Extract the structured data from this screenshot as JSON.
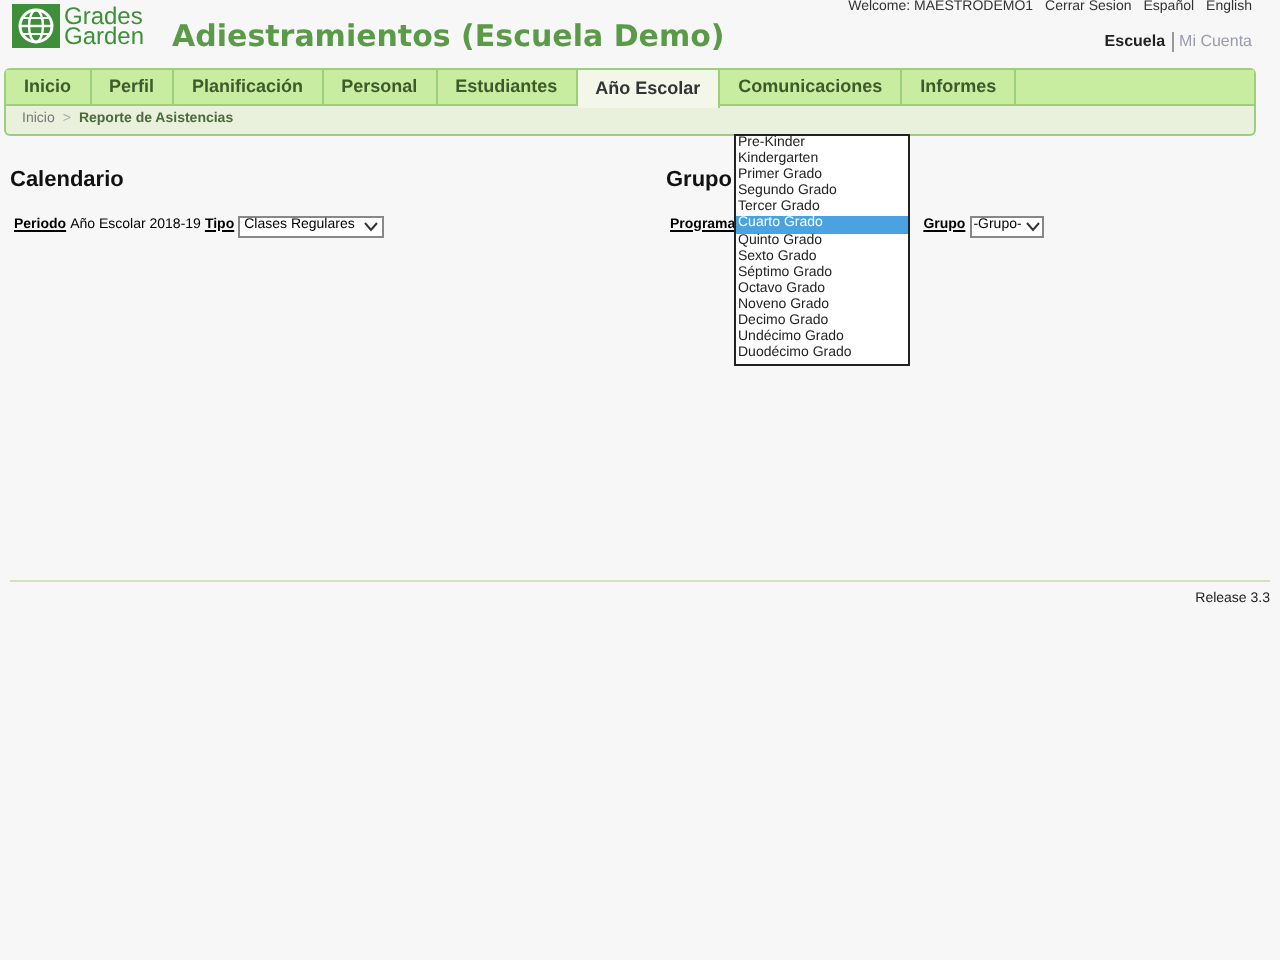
{
  "header": {
    "logo": {
      "line_1": "Grades",
      "line_2": "Garden"
    },
    "title": "Adiestramientos (Escuela Demo)",
    "user_links": [
      "Welcome: MAESTRODEMO1",
      "Cerrar Sesion",
      "Español",
      "English"
    ],
    "account_links": [
      {
        "label": "Escuela",
        "selected": true
      },
      {
        "label": "Mi Cuenta",
        "selected": false
      }
    ]
  },
  "nav_tabs": [
    {
      "label": "Inicio",
      "selected": false
    },
    {
      "label": "Perfil",
      "selected": false
    },
    {
      "label": "Planificación",
      "selected": false
    },
    {
      "label": "Personal",
      "selected": false
    },
    {
      "label": "Estudiantes",
      "selected": false
    },
    {
      "label": "Año Escolar",
      "selected": true
    },
    {
      "label": "Comunicaciones",
      "selected": false
    },
    {
      "label": "Informes",
      "selected": false
    }
  ],
  "breadcrumb": [
    "Inicio",
    "Reporte de Asistencias"
  ],
  "breadcrumb_separator": ">",
  "calendar": {
    "heading": "Calendario",
    "period_label": "Periodo",
    "period_value": "Año Escolar 2018-19",
    "type_label": "Tipo",
    "type_value": "Clases Regulares"
  },
  "group": {
    "heading": "Grupo",
    "program_label": "Programa",
    "group_label": "Grupo",
    "group_value": "-Grupo-",
    "program_options": [
      {
        "label": "Pre-Kinder",
        "selected": false
      },
      {
        "label": "Kindergarten",
        "selected": false
      },
      {
        "label": "Primer Grado",
        "selected": false
      },
      {
        "label": "Segundo Grado",
        "selected": false
      },
      {
        "label": "Tercer Grado",
        "selected": false
      },
      {
        "label": "Cuarto Grado",
        "selected": true
      },
      {
        "label": "Quinto Grado",
        "selected": false
      },
      {
        "label": "Sexto Grado",
        "selected": false
      },
      {
        "label": "Séptimo Grado",
        "selected": false
      },
      {
        "label": "Octavo Grado",
        "selected": false
      },
      {
        "label": "Noveno Grado",
        "selected": false
      },
      {
        "label": "Decimo Grado",
        "selected": false
      },
      {
        "label": "Undécimo Grado",
        "selected": false
      },
      {
        "label": "Duodécimo Grado",
        "selected": false
      }
    ]
  },
  "footer": {
    "release": "Release 3.3"
  }
}
